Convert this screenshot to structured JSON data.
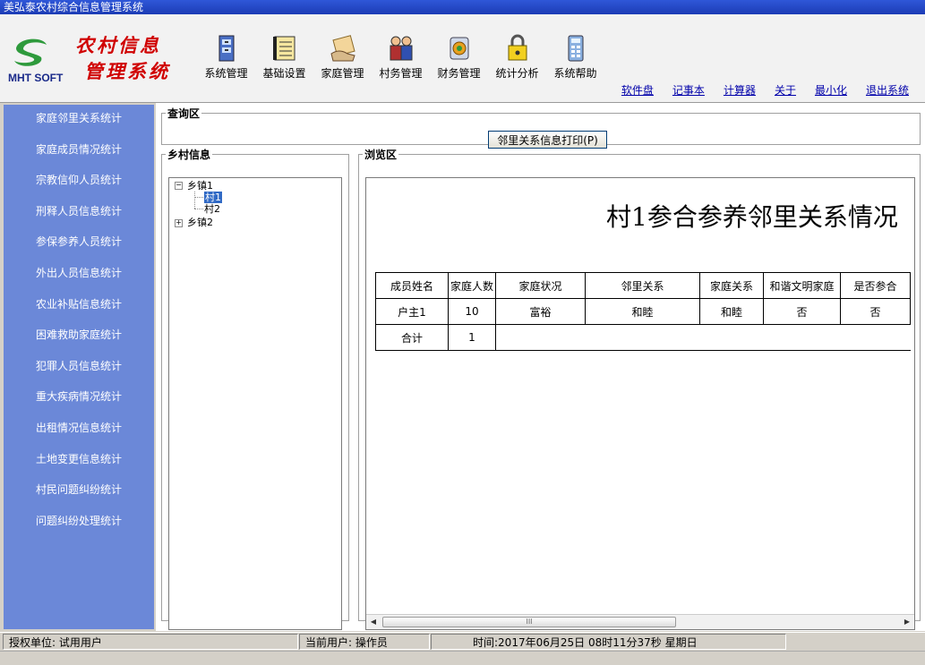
{
  "window": {
    "title": "美弘泰农村综合信息管理系统"
  },
  "logo": {
    "text": "MHT SOFT",
    "brand_line1": "农村信息",
    "brand_line2": "管理系统"
  },
  "toolbar": [
    {
      "label": "系统管理",
      "icon": "file-cabinet-icon"
    },
    {
      "label": "基础设置",
      "icon": "notebook-icon"
    },
    {
      "label": "家庭管理",
      "icon": "folder-hand-icon"
    },
    {
      "label": "村务管理",
      "icon": "people-icon"
    },
    {
      "label": "财务管理",
      "icon": "money-bag-icon"
    },
    {
      "label": "统计分析",
      "icon": "lock-chart-icon"
    },
    {
      "label": "系统帮助",
      "icon": "calculator-icon"
    }
  ],
  "links": [
    "软件盘",
    "记事本",
    "计算器",
    "关于",
    "最小化",
    "退出系统"
  ],
  "sidebar": {
    "items": [
      "家庭邻里关系统计",
      "家庭成员情况统计",
      "宗教信仰人员统计",
      "刑释人员信息统计",
      "参保参养人员统计",
      "外出人员信息统计",
      "农业补贴信息统计",
      "困难救助家庭统计",
      "犯罪人员信息统计",
      "重大疾病情况统计",
      "出租情况信息统计",
      "土地变更信息统计",
      "村民问题纠纷统计",
      "问题纠纷处理统计"
    ]
  },
  "query": {
    "legend": "查询区",
    "print_button": "邻里关系信息打印(P)"
  },
  "village": {
    "legend": "乡村信息",
    "tree": {
      "town1": "乡镇1",
      "village1": "村1",
      "village2": "村2",
      "town2": "乡镇2"
    }
  },
  "preview": {
    "legend": "浏览区",
    "report_title": "村1参合参养邻里关系情况",
    "headers": [
      "成员姓名",
      "家庭人数",
      "家庭状况",
      "邻里关系",
      "家庭关系",
      "和谐文明家庭",
      "是否参合"
    ],
    "rows": [
      [
        "户主1",
        "10",
        "富裕",
        "和睦",
        "和睦",
        "否",
        "否"
      ]
    ],
    "total": {
      "label": "合计",
      "value": "1"
    },
    "scrollbar_thumb": "III"
  },
  "status": {
    "unit_label": "授权单位:",
    "unit_value": "试用用户",
    "user_label": "当前用户:",
    "user_value": "操作员",
    "time_label": "时间:",
    "time_value": "2017年06月25日 08时11分37秒 星期日"
  },
  "colors": {
    "sidebar_bg": "#6b88d8",
    "brand_red": "#d00000",
    "logo_green": "#2e9a3c",
    "selection": "#316ac5",
    "link": "#0000aa"
  }
}
